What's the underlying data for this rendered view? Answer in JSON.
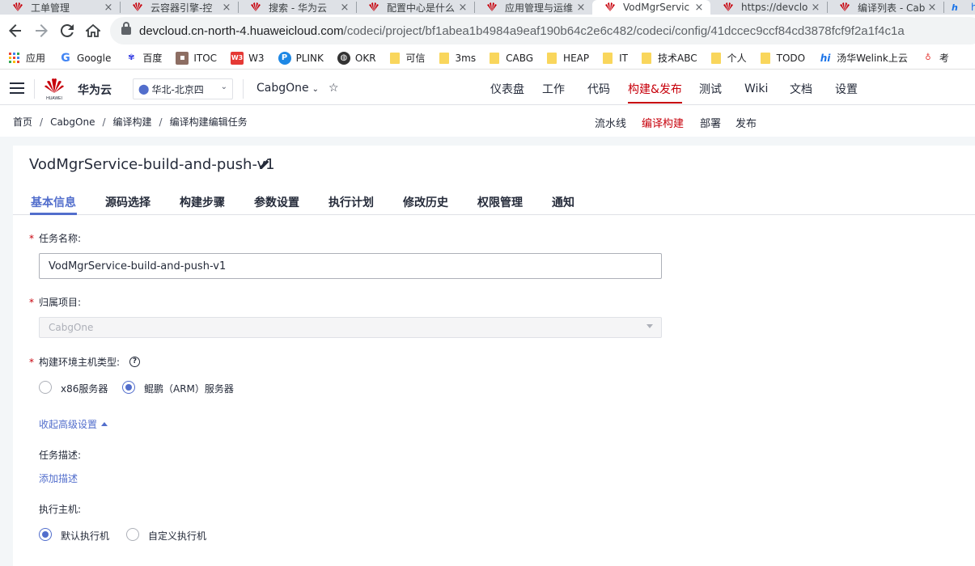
{
  "browser": {
    "tabs": [
      {
        "title": "工单管理"
      },
      {
        "title": "云容器引擎-控"
      },
      {
        "title": "搜索 - 华为云"
      },
      {
        "title": "配置中心是什么"
      },
      {
        "title": "应用管理与运维"
      },
      {
        "title": "VodMgrServic"
      },
      {
        "title": "https://devclo"
      },
      {
        "title": "编译列表 - Cab"
      },
      {
        "title": "h"
      }
    ],
    "url_host": "devcloud.cn-north-4.huaweicloud.com",
    "url_path": "/codeci/project/bf1abea1b4984a9eaf190b64c2e6c482/codeci/config/41dccec9ccf84cd3878fcf9f2a1f4c1a",
    "bookmarks": [
      "应用",
      "Google",
      "百度",
      "ITOC",
      "W3",
      "PLINK",
      "OKR",
      "可信",
      "3ms",
      "CABG",
      "HEAP",
      "IT",
      "技术ABC",
      "个人",
      "TODO",
      "汤华Welink上云",
      "考"
    ]
  },
  "header": {
    "logo_text": "HUAWEI",
    "brand": "华为云",
    "region": "华北-北京四",
    "project": "CabgOne",
    "nav": [
      "仪表盘",
      "工作",
      "代码",
      "构建&发布",
      "测试",
      "Wiki",
      "文档",
      "设置"
    ],
    "active_nav": "构建&发布"
  },
  "breadcrumb": [
    "首页",
    "CabgOne",
    "编译构建",
    "编译构建编辑任务"
  ],
  "subnav": [
    "流水线",
    "编译构建",
    "部署",
    "发布"
  ],
  "job": {
    "title": "VodMgrService-build-and-push-v1",
    "tabs": [
      "基本信息",
      "源码选择",
      "构建步骤",
      "参数设置",
      "执行计划",
      "修改历史",
      "权限管理",
      "通知"
    ]
  },
  "form": {
    "required_mark": "*",
    "name_label": "任务名称:",
    "name_value": "VodMgrService-build-and-push-v1",
    "project_label": "归属项目:",
    "project_value": "CabgOne",
    "host_type_label": "构建环境主机类型:",
    "help_glyph": "?",
    "host_type_options": [
      "x86服务器",
      "鲲鹏（ARM）服务器"
    ],
    "host_type_selected": "鲲鹏（ARM）服务器",
    "advanced_toggle": "收起高级设置",
    "desc_label": "任务描述:",
    "desc_add": "添加描述",
    "executor_label": "执行主机:",
    "executor_options": [
      "默认执行机",
      "自定义执行机"
    ],
    "executor_selected": "默认执行机"
  },
  "colors": {
    "brand_red": "#c7000b",
    "primary_blue": "#526ecc"
  }
}
